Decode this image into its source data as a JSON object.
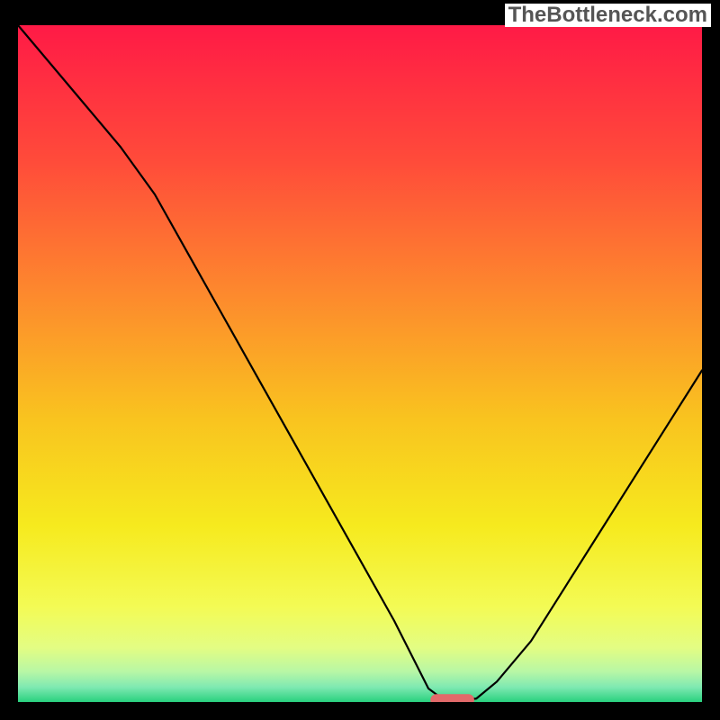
{
  "watermark": "TheBottleneck.com",
  "chart_data": {
    "type": "line",
    "title": "",
    "xlabel": "",
    "ylabel": "",
    "xlim": [
      0,
      100
    ],
    "ylim": [
      0,
      100
    ],
    "grid": false,
    "legend": false,
    "series": [
      {
        "name": "bottleneck-curve",
        "color": "#000000",
        "x": [
          0,
          5,
          10,
          15,
          20,
          25,
          30,
          35,
          40,
          45,
          50,
          55,
          58,
          60,
          62,
          64,
          65,
          67,
          70,
          75,
          80,
          85,
          90,
          95,
          100
        ],
        "y": [
          100,
          94,
          88,
          82,
          75,
          66,
          57,
          48,
          39,
          30,
          21,
          12,
          6,
          2,
          0.5,
          0.3,
          0.3,
          0.5,
          3,
          9,
          17,
          25,
          33,
          41,
          49
        ]
      }
    ],
    "marker": {
      "name": "optimal-range",
      "shape": "pill",
      "color": "#e26a6a",
      "x_center": 63.5,
      "x_halfwidth": 3.2,
      "y": 0.3
    },
    "background_gradient": {
      "direction": "vertical",
      "stops": [
        {
          "pos": 0.0,
          "color": "#ff1a46"
        },
        {
          "pos": 0.2,
          "color": "#ff4b3a"
        },
        {
          "pos": 0.4,
          "color": "#fd8a2d"
        },
        {
          "pos": 0.58,
          "color": "#f9c31f"
        },
        {
          "pos": 0.74,
          "color": "#f6ea1e"
        },
        {
          "pos": 0.86,
          "color": "#f3fb55"
        },
        {
          "pos": 0.92,
          "color": "#e3fd83"
        },
        {
          "pos": 0.955,
          "color": "#b8f7a5"
        },
        {
          "pos": 0.978,
          "color": "#7fe9b2"
        },
        {
          "pos": 1.0,
          "color": "#29d17e"
        }
      ]
    }
  }
}
